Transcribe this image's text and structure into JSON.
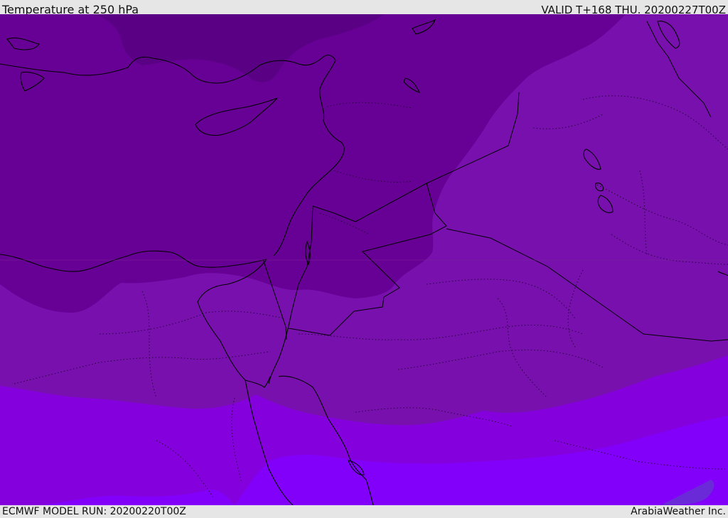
{
  "header": {
    "title": "Temperature at 250 hPa",
    "valid": "VALID T+168 THU. 20200227T00Z"
  },
  "footer": {
    "model_run": "ECMWF MODEL RUN: 20200220T00Z",
    "credit": "ArabiaWeather Inc."
  },
  "map": {
    "variable": "temperature",
    "level": "250 hPa",
    "palette": {
      "band_coldest": "#5a0085",
      "band_cold": "#670094",
      "band_mid": "#7810ae",
      "band_warm": "#8400dc",
      "band_warmest": "#8200fa",
      "band_patch": "#6a2ad8",
      "coastline": "#000000",
      "border": "#000000",
      "province_border": "#2a0040"
    }
  }
}
